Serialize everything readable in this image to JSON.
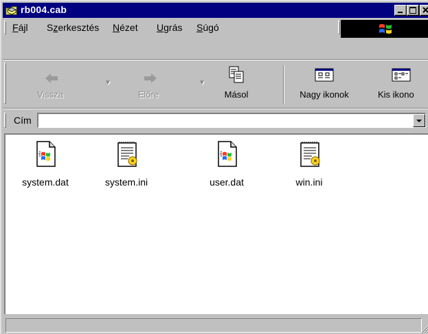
{
  "window": {
    "title": "rb004.cab"
  },
  "menu": {
    "items": [
      {
        "label": "Fájl"
      },
      {
        "label": "Szerkesztés"
      },
      {
        "label": "Nézet"
      },
      {
        "label": "Ugrás"
      },
      {
        "label": "Súgó"
      }
    ]
  },
  "toolbar": {
    "back_label": "Vissza",
    "forward_label": "Előre",
    "copy_label": "Másol",
    "large_icons_label": "Nagy ikonok",
    "small_icons_label": "Kis ikono"
  },
  "address": {
    "label": "Cím",
    "value": ""
  },
  "files": [
    {
      "name": "system.dat",
      "icon": "dat-file-icon"
    },
    {
      "name": "system.ini",
      "icon": "ini-file-icon"
    },
    {
      "name": "user.dat",
      "icon": "dat-file-icon"
    },
    {
      "name": "win.ini",
      "icon": "ini-file-icon"
    }
  ],
  "status": {
    "text": ""
  },
  "colors": {
    "titlebar": "#000080",
    "face": "#c0c0c0",
    "pane": "#ffffff"
  }
}
